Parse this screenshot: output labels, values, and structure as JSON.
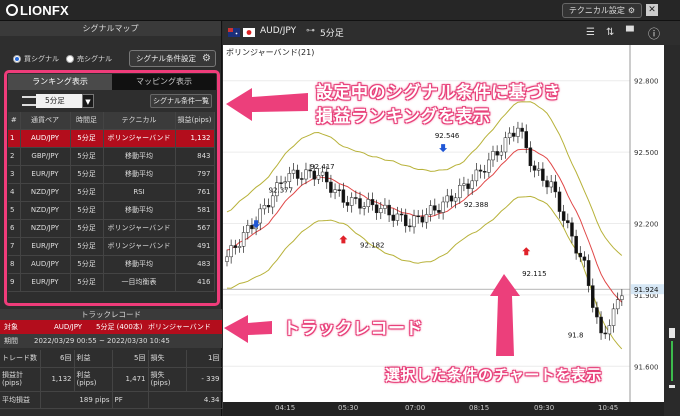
{
  "app": {
    "logo": "LIONFX",
    "tech_settings": "テクニカル設定"
  },
  "left": {
    "title": "シグナルマップ",
    "radio_buy": "買シグナル",
    "radio_sell": "売シグナル",
    "condition_button": "シグナル条件設定",
    "tab_ranking": "ランキング表示",
    "tab_mapping": "マッピング表示",
    "timeframe": "5分足",
    "condition_list": "シグナル条件一覧",
    "table_headers": [
      "#",
      "通貨ペア",
      "時間足",
      "テクニカル",
      "損益(pips)"
    ],
    "rows": [
      [
        "1",
        "AUD/JPY",
        "5分足",
        "ボリンジャーバンド",
        "1,132"
      ],
      [
        "2",
        "GBP/JPY",
        "5分足",
        "移動平均",
        "843"
      ],
      [
        "3",
        "EUR/JPY",
        "5分足",
        "移動平均",
        "797"
      ],
      [
        "4",
        "NZD/JPY",
        "5分足",
        "RSI",
        "761"
      ],
      [
        "5",
        "NZD/JPY",
        "5分足",
        "移動平均",
        "581"
      ],
      [
        "6",
        "NZD/JPY",
        "5分足",
        "ボリンジャーバンド",
        "567"
      ],
      [
        "7",
        "EUR/JPY",
        "5分足",
        "ボリンジャーバンド",
        "491"
      ],
      [
        "8",
        "AUD/JPY",
        "5分足",
        "移動平均",
        "483"
      ],
      [
        "9",
        "EUR/JPY",
        "5分足",
        "一目均衡表",
        "416"
      ]
    ],
    "track_title": "トラックレコード",
    "track_head": {
      "label": "対象",
      "pair": "AUD/JPY",
      "bars": "5分足 (400本)",
      "tech": "ボリンジャーバンド"
    },
    "track_period": {
      "label": "期間",
      "value": "2022/03/29 00:55 ~ 2022/03/30 10:45"
    },
    "stats": {
      "trades_label": "トレード数",
      "trades": "6回",
      "profit_label": "利益",
      "profit": "5回",
      "loss_label": "損失",
      "loss": "1回",
      "pl_total_label": "損益計\n(pips)",
      "pl_total": "1,132",
      "profit_pips_label": "利益\n(pips)",
      "profit_pips": "1,471",
      "loss_pips_label": "損失\n(pips)",
      "loss_pips": "- 339",
      "avg_label": "平均損益",
      "avg": "189 pips",
      "pf_label": "PF",
      "pf": "4.34"
    }
  },
  "chart": {
    "pair": "AUD/JPY",
    "timeframe": "5分足",
    "indicator": "ボリンジャーバンド(21)",
    "price_ticks": [
      "92.800",
      "92.500",
      "92.200",
      "91.900",
      "91.600"
    ],
    "current_price": "91.924",
    "time_ticks": [
      "04:15",
      "05:30",
      "07:00",
      "08:15",
      "09:30",
      "10:45"
    ],
    "labels": [
      "92.377",
      "92.417",
      "92.546",
      "92.182",
      "92.388",
      "92.115",
      "91.8"
    ],
    "colors": {
      "upper_band": "#b8b23a",
      "mid_band": "#e04848",
      "bull": "#ffffff",
      "bear": "#111111",
      "buy_signal": "#1f56d6",
      "sell_signal": "#e0222a"
    }
  },
  "annotations": {
    "line1": "設定中のシグナル条件に基づき",
    "line2": "損益ランキングを表示",
    "track": "トラックレコード",
    "chart": "選択した条件のチャートを表示"
  },
  "chart_data": {
    "type": "candlestick",
    "title": "ボリンジャーバンド(21)",
    "xlabel": "",
    "ylabel": "",
    "x_ticks": [
      "04:15",
      "05:30",
      "07:00",
      "08:15",
      "09:30",
      "10:45"
    ],
    "y_ticks": [
      92.8,
      92.5,
      92.2,
      91.9,
      91.6
    ],
    "ylim": [
      91.45,
      92.95
    ],
    "annotated_prices": [
      92.377,
      92.417,
      92.546,
      92.182,
      92.388,
      92.115
    ],
    "current_price": 91.924
  }
}
